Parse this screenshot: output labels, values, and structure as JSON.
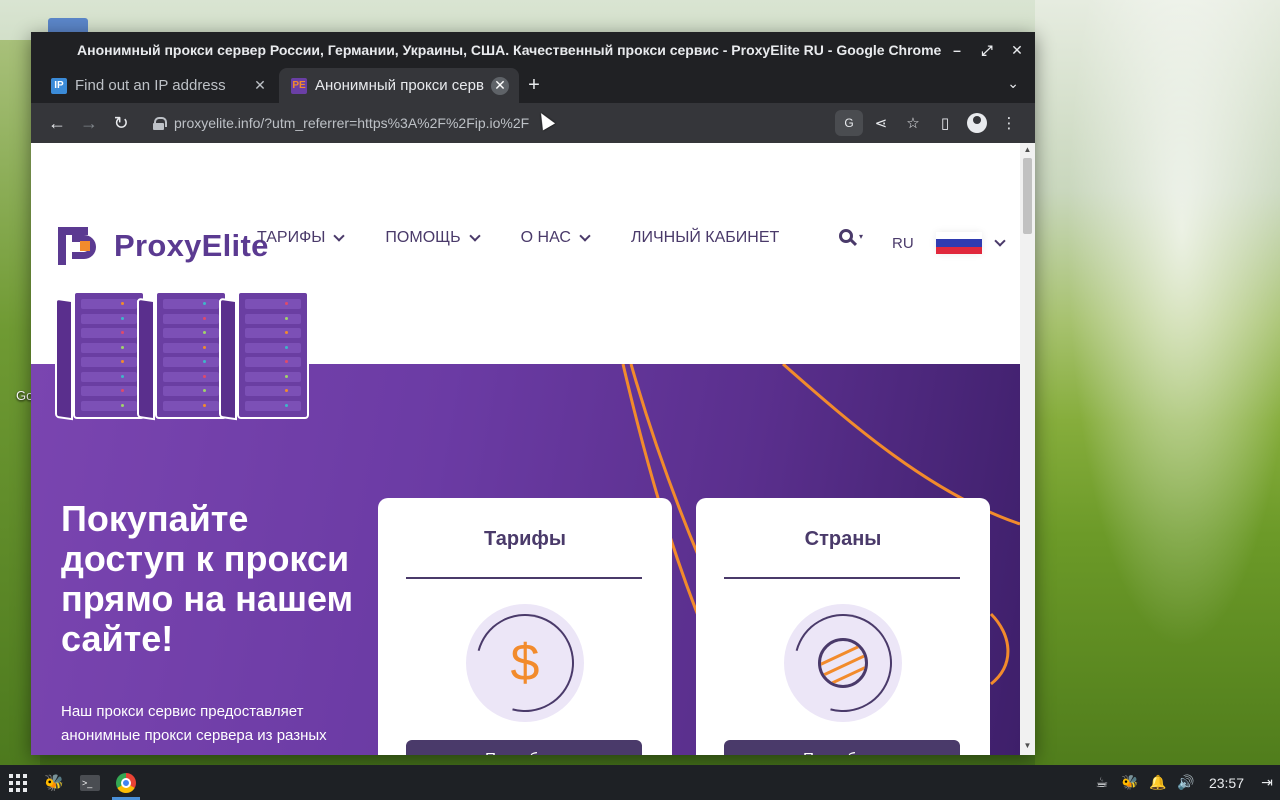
{
  "desktop": {
    "partial_label": "Go"
  },
  "window": {
    "title": "Анонимный прокси сервер России, Германии, Украины, США. Качественный прокси сервис - ProxyElite RU - Google Chrome",
    "controls": {
      "minimize": "–",
      "maximize": "⤢",
      "close": "✕"
    }
  },
  "tabs": [
    {
      "favicon": "IP",
      "title": "Find out an IP address",
      "close": "✕",
      "active": false
    },
    {
      "favicon": "PE",
      "title": "Анонимный прокси серв",
      "close": "✕",
      "active": true
    }
  ],
  "tabstrip": {
    "new_tab": "+",
    "tab_search": "⌄"
  },
  "toolbar": {
    "back": "←",
    "forward": "→",
    "reload": "↻",
    "url": "proxyelite.info/?utm_referrer=https%3A%2F%2Fip.io%2F",
    "translate": "G",
    "share": "⋖",
    "bookmark": "☆",
    "sidepanel": "▯",
    "menu": "⋮"
  },
  "site": {
    "logo_text": "ProxyElite",
    "nav": [
      {
        "label": "ТАРИФЫ",
        "has_dropdown": true
      },
      {
        "label": "ПОМОЩЬ",
        "has_dropdown": true
      },
      {
        "label": "О НАС",
        "has_dropdown": true
      },
      {
        "label": "ЛИЧНЫЙ КАБИНЕТ",
        "has_dropdown": false
      }
    ],
    "search_caret": "▾",
    "lang": "RU",
    "flag_colors": [
      "#ffffff",
      "#2f3bb0",
      "#e0283c"
    ]
  },
  "hero": {
    "title": "Покупайте доступ к прокси прямо на нашем сайте!",
    "description": "Наш прокси сервис предоставляет анонимные прокси сервера из разных",
    "cards": [
      {
        "title": "Тарифы",
        "icon": "dollar-icon",
        "glyph": "$",
        "button": "Подробнее"
      },
      {
        "title": "Страны",
        "icon": "globe-icon",
        "glyph": "",
        "button": "Подробнее"
      }
    ]
  },
  "colors": {
    "brand_purple": "#5b3a91",
    "hero_purple": "#6b3ba4",
    "accent_orange": "#f28b2c",
    "card_text": "#4a3a6a"
  },
  "taskbar": {
    "clock": "23:57"
  }
}
